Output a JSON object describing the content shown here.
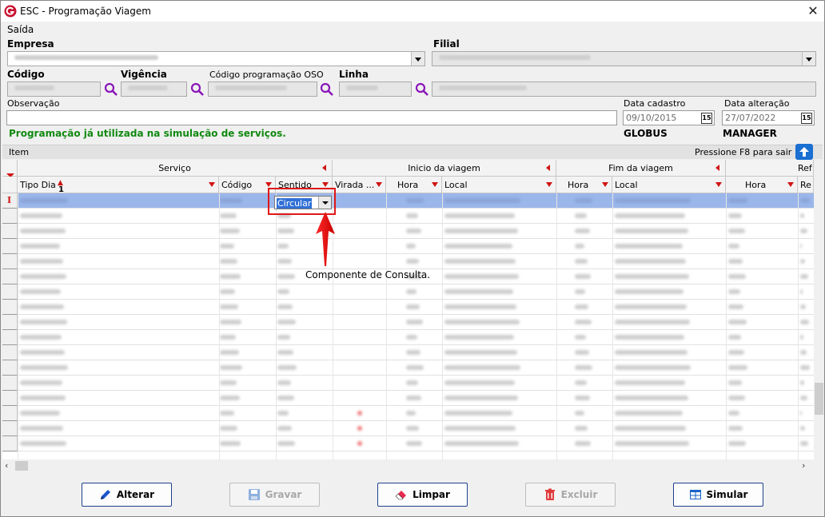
{
  "window": {
    "title": "ESC - Programação Viagem",
    "close": "✕"
  },
  "menu": {
    "saida": "Saída"
  },
  "form": {
    "empresa_label": "Empresa",
    "filial_label": "Filial",
    "codigo_label": "Código",
    "vigencia_label": "Vigência",
    "codigo_oso_label": "Código programação OSO",
    "linha_label": "Linha",
    "observacao_label": "Observação",
    "data_cadastro_label": "Data cadastro",
    "data_cadastro_value": "09/10/2015",
    "data_cadastro_user": "GLOBUS",
    "data_alteracao_label": "Data alteração",
    "data_alteracao_value": "27/07/2022",
    "data_alteracao_user": "MANAGER",
    "calendar_icon_text": "15"
  },
  "status_message": "Programação já utilizada na simulação de serviços.",
  "grid": {
    "item_label": "Item",
    "f8_hint": "Pressione F8 para sair",
    "group_servico": "Serviço",
    "group_inicio": "Inicio da viagem",
    "group_fim": "Fim da viagem",
    "group_ref": "Ref",
    "col_tipo_dia": "Tipo Dia",
    "col_sort_index": "1",
    "col_codigo": "Código",
    "col_sentido": "Sentido",
    "col_virada": "Virada ...",
    "col_hora1": "Hora",
    "col_local1": "Local",
    "col_hora2": "Hora",
    "col_local2": "Local",
    "col_hora3": "Hora",
    "col_re": "Re",
    "current_row_marker": "I",
    "combo_value": "Circular"
  },
  "annotation": "Componente de Consulta.",
  "buttons": {
    "alterar": "Alterar",
    "gravar": "Gravar",
    "limpar": "Limpar",
    "excluir": "Excluir",
    "simular": "Simular"
  },
  "colors": {
    "accent_red": "#e01818",
    "status_green": "#118a11",
    "selection": "#9ab6ea",
    "button_border": "#1f3f8f"
  }
}
